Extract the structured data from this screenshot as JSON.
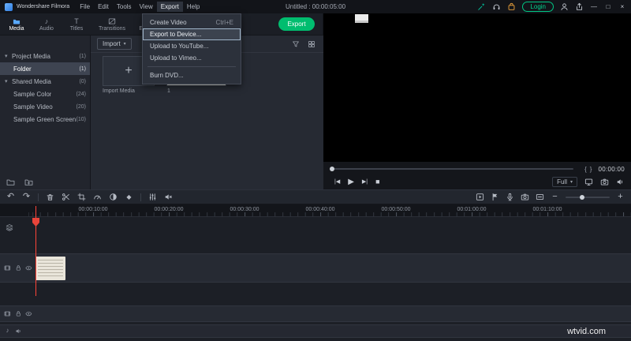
{
  "colors": {
    "accent_green": "#00c583",
    "export_button_green": "#00bd6f",
    "playhead_red": "#ff4438",
    "menu_highlight_border": "#9fb4c8"
  },
  "menubar": {
    "app_name": "Wondershare Filmora",
    "menus": [
      "File",
      "Edit",
      "Tools",
      "View",
      "Export",
      "Help"
    ],
    "title": "Untitled : 00:00:05:00",
    "login_label": "Login"
  },
  "export_menu": {
    "items": [
      {
        "label": "Create Video",
        "shortcut": "Ctrl+E"
      },
      {
        "label": "Export to Device...",
        "shortcut": ""
      },
      {
        "label": "Upload to YouTube...",
        "shortcut": ""
      },
      {
        "label": "Upload to Vimeo...",
        "shortcut": ""
      },
      {
        "label": "Burn DVD...",
        "shortcut": ""
      }
    ],
    "highlighted_item": "Export to Device..."
  },
  "tabstrip": {
    "tabs": [
      "Media",
      "Audio",
      "Titles",
      "Transitions",
      "Effects"
    ],
    "active_tab": "Media",
    "export_button": "Export"
  },
  "sidebar": {
    "items": [
      {
        "label": "Project Media",
        "count": "(1)"
      },
      {
        "label": "Folder",
        "count": "(1)"
      },
      {
        "label": "Shared Media",
        "count": "(0)"
      },
      {
        "label": "Sample Color",
        "count": "(24)"
      },
      {
        "label": "Sample Video",
        "count": "(20)"
      },
      {
        "label": "Sample Green Screen",
        "count": "(10)"
      }
    ],
    "selected_item": "Folder"
  },
  "media_panel": {
    "import_button": "Import",
    "import_media_label": "Import Media",
    "media_item_label": "1"
  },
  "preview": {
    "timecode": "00:00:00",
    "view_mode": "Full"
  },
  "timeline": {
    "ruler_labels": [
      "00:00:10:00",
      "00:00:20:00",
      "00:00:30:00",
      "00:00:40:00",
      "00:00:50:00",
      "00:01:00:00",
      "00:01:10:00"
    ]
  },
  "watermark": "wtvid.com",
  "icons": {
    "caret_down": "▾",
    "plus": "+",
    "zoom_out": "−",
    "check": "✓",
    "undo": "↶",
    "redo": "↷",
    "diamond": "◆",
    "play": "▶",
    "stop": "■",
    "prev_frame": "|◀",
    "next_frame": "▶|",
    "music_note": "♪",
    "brace_left": "{",
    "brace_right": "}",
    "minimize": "—",
    "maximize": "□",
    "close": "×",
    "fx": "fx",
    "titles": "T"
  }
}
